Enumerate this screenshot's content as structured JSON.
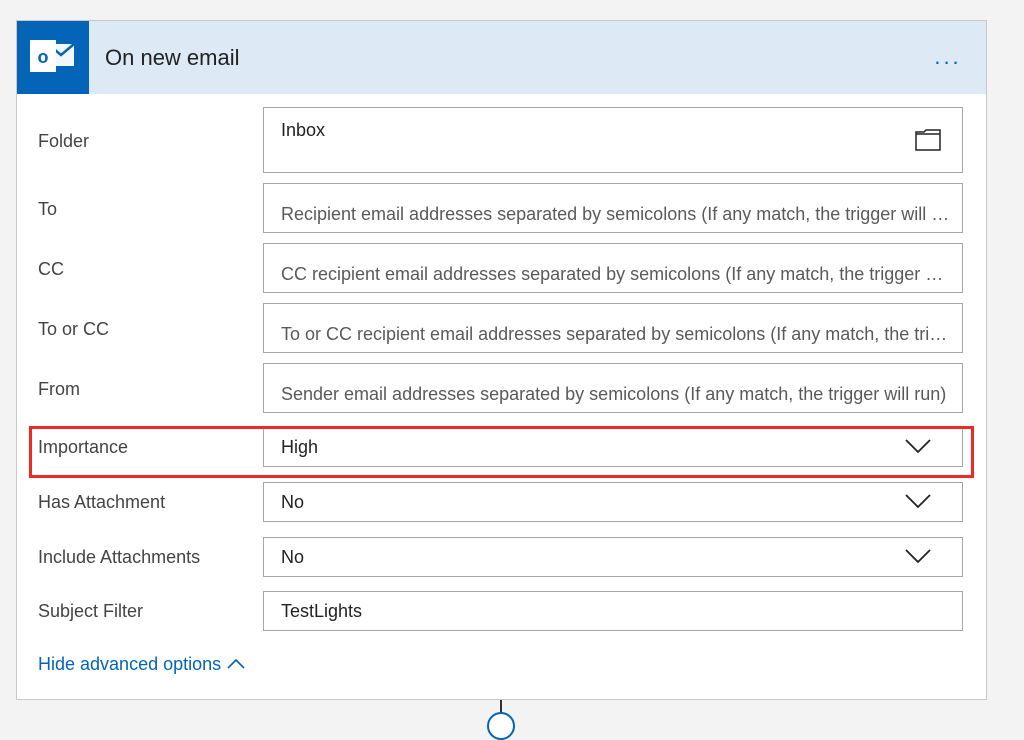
{
  "header": {
    "title": "On new email",
    "icon": "outlook-icon",
    "more_label": "...",
    "brand_color": "#0364b8",
    "header_bg": "#dde9f5"
  },
  "fields": {
    "folder": {
      "label": "Folder",
      "value": "Inbox",
      "icon": "folder-icon"
    },
    "to": {
      "label": "To",
      "placeholder": "Recipient email addresses separated by semicolons (If any match, the trigger will run)"
    },
    "cc": {
      "label": "CC",
      "placeholder": "CC recipient email addresses separated by semicolons (If any match, the trigger will run)"
    },
    "to_or_cc": {
      "label": "To or CC",
      "placeholder": "To or CC recipient email addresses separated by semicolons (If any match, the trigger will run)"
    },
    "from": {
      "label": "From",
      "placeholder": "Sender email addresses separated by semicolons (If any match, the trigger will run)"
    },
    "importance": {
      "label": "Importance",
      "value": "High",
      "highlighted": true,
      "highlight_color": "#ee2a24"
    },
    "has_attachment": {
      "label": "Has Attachment",
      "value": "No"
    },
    "include_attachments": {
      "label": "Include Attachments",
      "value": "No"
    },
    "subject_filter": {
      "label": "Subject Filter",
      "value": "TestLights"
    }
  },
  "advanced": {
    "label": "Hide advanced options",
    "icon": "chevron-up-icon"
  }
}
